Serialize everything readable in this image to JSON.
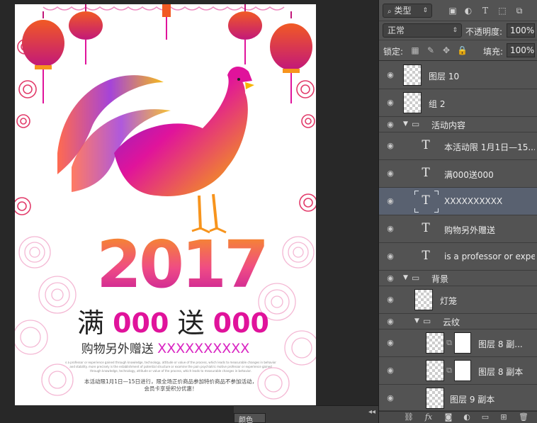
{
  "poster": {
    "year": "2017",
    "offer_prefix": "满",
    "offer_amount1": "000",
    "offer_mid": "送",
    "offer_amount2": "000",
    "gift_prefix": "购物另外赠送",
    "gift_x": "XXXXXXXXXX",
    "fine_print": "s a professor or experience gained through knowledge, technology, attitude or value of the process, which leads to measurable changes in behavior and stability. more precisely is the establishment of potential structure or examine the pain psychiatric motive professor or experience gained through knowledge, technology, attitude or value of the process, which leads to measurable changes in behavior.",
    "event_line1": "本活动限1月1日—15日进行，限全场正价商品参加特价商品不参加活动，",
    "event_line2": "会员卡享受积分优惠！"
  },
  "canvas_bottom": {
    "color_tab": "颜色",
    "collapse_arrows": "◂◂"
  },
  "layers_panel": {
    "filter_label": "类型",
    "blend_mode": "正常",
    "opacity_label": "不透明度:",
    "opacity_value": "100%",
    "lock_label": "锁定:",
    "fill_label": "填充:",
    "fill_value": "100%",
    "layers": [
      {
        "name": "图层 10",
        "kind": "image"
      },
      {
        "name": "组 2",
        "kind": "smart"
      },
      {
        "name": "活动内容",
        "kind": "group"
      },
      {
        "name": "本活动限 1月1日—15...",
        "kind": "text"
      },
      {
        "name": "满000送000",
        "kind": "text"
      },
      {
        "name": "XXXXXXXXXX",
        "kind": "text",
        "selected": true
      },
      {
        "name": "购物另外赠送",
        "kind": "text"
      },
      {
        "name": "is a professor or expe...",
        "kind": "text"
      },
      {
        "name": "背景",
        "kind": "group"
      },
      {
        "name": "灯笼",
        "kind": "image"
      },
      {
        "name": "云纹",
        "kind": "group"
      },
      {
        "name": "图层 8 副...",
        "kind": "masked"
      },
      {
        "name": "图层 8 副本",
        "kind": "masked"
      },
      {
        "name": "图层 9 副本",
        "kind": "image"
      }
    ]
  },
  "colors": {
    "panel_bg": "#535353",
    "selected_row": "#596170",
    "accent_pink": "#e0139b",
    "accent_orange": "#f7941d"
  }
}
